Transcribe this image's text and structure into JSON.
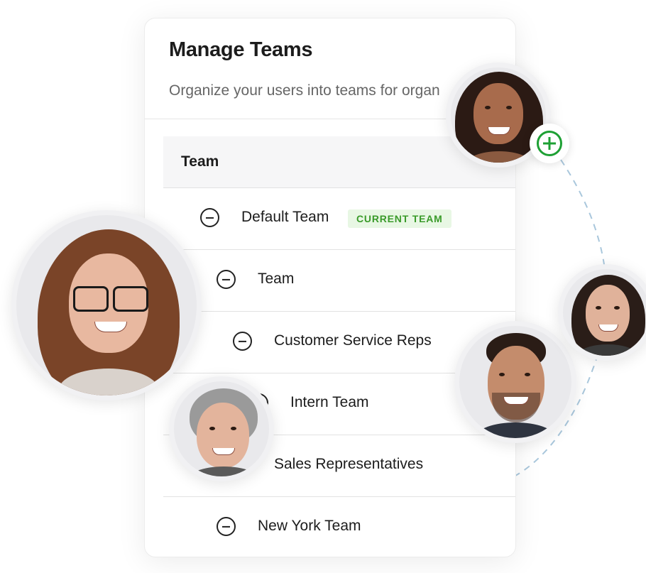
{
  "title": "Manage Teams",
  "subtitle": "Organize your users into teams for organ",
  "table": {
    "header": "Team",
    "rows": [
      {
        "label": "Default Team",
        "badge": "CURRENT TEAM"
      },
      {
        "label": "Team"
      },
      {
        "label": "Customer Service Reps"
      },
      {
        "label": "Intern Team"
      },
      {
        "label": "Sales Representatives"
      },
      {
        "label": "New York Team"
      }
    ]
  },
  "icons": {
    "row_toggle": "minus-circle-icon",
    "add": "plus-circle-icon"
  },
  "colors": {
    "badge_text": "#3a9b2a",
    "badge_bg": "#e8f7e4",
    "add_icon": "#1ea034",
    "connector": "#a9c7dc"
  }
}
